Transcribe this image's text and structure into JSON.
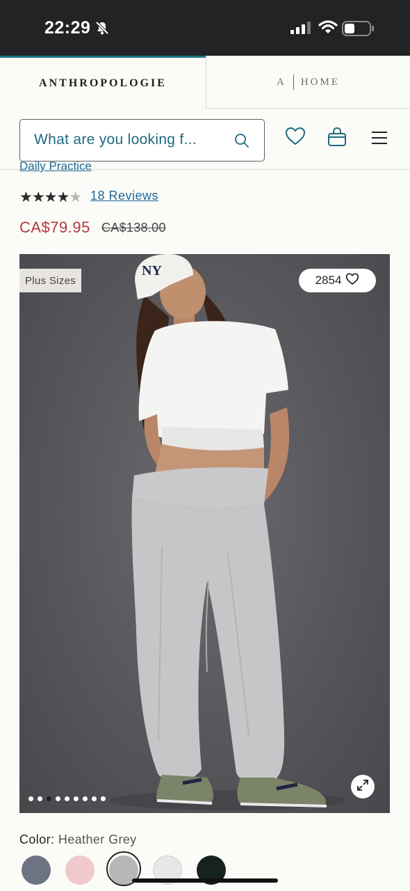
{
  "status_bar": {
    "time": "22:29"
  },
  "brand_tabs": {
    "primary": "ANTHROPOLOGIE",
    "secondary_a": "A",
    "secondary_home": "HOME"
  },
  "search": {
    "placeholder": "What are you looking f..."
  },
  "header_icons": [
    "search-icon",
    "heart-icon",
    "bag-icon",
    "menu-icon"
  ],
  "product": {
    "brand_link": "Daily Practice",
    "rating": 4,
    "rating_max": 5,
    "reviews_label": "18 Reviews",
    "price_sale": "CA$79.95",
    "price_original": "CA$138.00",
    "sale_color": "#b3373d"
  },
  "image": {
    "badge": "Plus Sizes",
    "likes": "2854",
    "total_slides": 9,
    "active_slide": 2
  },
  "color": {
    "label": "Color:",
    "selected": "Heather Grey",
    "swatches": [
      {
        "name": "Slate Blue",
        "hex": "#6e7384"
      },
      {
        "name": "Pink",
        "hex": "#f0c9cc"
      },
      {
        "name": "Heather Grey",
        "hex": "#b8b6b9",
        "selected": true
      },
      {
        "name": "Light Grey",
        "hex": "#e8e6e6"
      },
      {
        "name": "Dark Green",
        "hex": "#16221d"
      }
    ]
  },
  "accent_color": "#1e7385"
}
